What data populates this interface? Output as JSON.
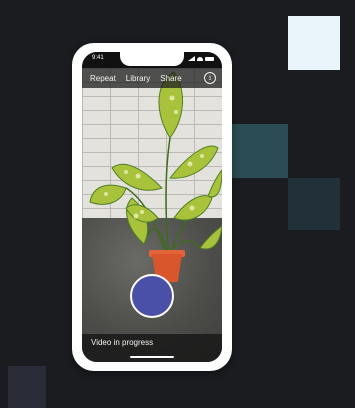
{
  "phone": {
    "status_bar": {
      "time": "9:41"
    },
    "toolbar": {
      "repeat_label": "Repeat",
      "library_label": "Library",
      "share_label": "Share",
      "info_glyph": "i",
      "info_icon": "info-circle-icon"
    },
    "camera": {
      "subject_icon": "houseplant",
      "record_button_color": "#4a4fa8"
    },
    "status_text": "Video in progress"
  },
  "colors": {
    "background": "#1a1c20",
    "accent_tile_light": "#e9f4fb",
    "accent_tile_teal": "#2c4c55"
  }
}
